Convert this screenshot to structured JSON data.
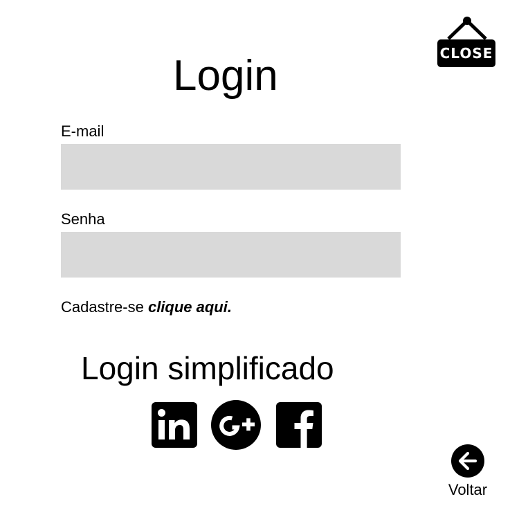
{
  "close": {
    "label": "CLOSE",
    "icon": "close-sign-icon"
  },
  "login": {
    "title": "Login",
    "email_label": "E-mail",
    "email_value": "",
    "senha_label": "Senha",
    "senha_value": "",
    "signup_text": "Cadastre-se ",
    "signup_link": "clique aqui."
  },
  "simplified": {
    "title": "Login simplificado",
    "providers": [
      {
        "name": "LinkedIn",
        "icon": "linkedin-icon"
      },
      {
        "name": "Google+",
        "icon": "google-plus-icon"
      },
      {
        "name": "Facebook",
        "icon": "facebook-icon"
      }
    ]
  },
  "back": {
    "label": "Voltar",
    "icon": "arrow-left-icon"
  },
  "colors": {
    "field_background": "#d9d9d9",
    "icon_fill": "#000000",
    "background": "#ffffff"
  }
}
